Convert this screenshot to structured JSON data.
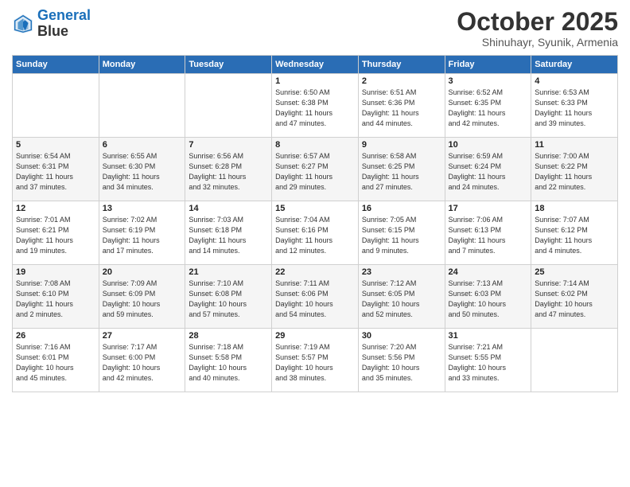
{
  "header": {
    "logo_line1": "General",
    "logo_line2": "Blue",
    "month": "October 2025",
    "location": "Shinuhayr, Syunik, Armenia"
  },
  "weekdays": [
    "Sunday",
    "Monday",
    "Tuesday",
    "Wednesday",
    "Thursday",
    "Friday",
    "Saturday"
  ],
  "weeks": [
    [
      {
        "day": "",
        "info": ""
      },
      {
        "day": "",
        "info": ""
      },
      {
        "day": "",
        "info": ""
      },
      {
        "day": "1",
        "info": "Sunrise: 6:50 AM\nSunset: 6:38 PM\nDaylight: 11 hours\nand 47 minutes."
      },
      {
        "day": "2",
        "info": "Sunrise: 6:51 AM\nSunset: 6:36 PM\nDaylight: 11 hours\nand 44 minutes."
      },
      {
        "day": "3",
        "info": "Sunrise: 6:52 AM\nSunset: 6:35 PM\nDaylight: 11 hours\nand 42 minutes."
      },
      {
        "day": "4",
        "info": "Sunrise: 6:53 AM\nSunset: 6:33 PM\nDaylight: 11 hours\nand 39 minutes."
      }
    ],
    [
      {
        "day": "5",
        "info": "Sunrise: 6:54 AM\nSunset: 6:31 PM\nDaylight: 11 hours\nand 37 minutes."
      },
      {
        "day": "6",
        "info": "Sunrise: 6:55 AM\nSunset: 6:30 PM\nDaylight: 11 hours\nand 34 minutes."
      },
      {
        "day": "7",
        "info": "Sunrise: 6:56 AM\nSunset: 6:28 PM\nDaylight: 11 hours\nand 32 minutes."
      },
      {
        "day": "8",
        "info": "Sunrise: 6:57 AM\nSunset: 6:27 PM\nDaylight: 11 hours\nand 29 minutes."
      },
      {
        "day": "9",
        "info": "Sunrise: 6:58 AM\nSunset: 6:25 PM\nDaylight: 11 hours\nand 27 minutes."
      },
      {
        "day": "10",
        "info": "Sunrise: 6:59 AM\nSunset: 6:24 PM\nDaylight: 11 hours\nand 24 minutes."
      },
      {
        "day": "11",
        "info": "Sunrise: 7:00 AM\nSunset: 6:22 PM\nDaylight: 11 hours\nand 22 minutes."
      }
    ],
    [
      {
        "day": "12",
        "info": "Sunrise: 7:01 AM\nSunset: 6:21 PM\nDaylight: 11 hours\nand 19 minutes."
      },
      {
        "day": "13",
        "info": "Sunrise: 7:02 AM\nSunset: 6:19 PM\nDaylight: 11 hours\nand 17 minutes."
      },
      {
        "day": "14",
        "info": "Sunrise: 7:03 AM\nSunset: 6:18 PM\nDaylight: 11 hours\nand 14 minutes."
      },
      {
        "day": "15",
        "info": "Sunrise: 7:04 AM\nSunset: 6:16 PM\nDaylight: 11 hours\nand 12 minutes."
      },
      {
        "day": "16",
        "info": "Sunrise: 7:05 AM\nSunset: 6:15 PM\nDaylight: 11 hours\nand 9 minutes."
      },
      {
        "day": "17",
        "info": "Sunrise: 7:06 AM\nSunset: 6:13 PM\nDaylight: 11 hours\nand 7 minutes."
      },
      {
        "day": "18",
        "info": "Sunrise: 7:07 AM\nSunset: 6:12 PM\nDaylight: 11 hours\nand 4 minutes."
      }
    ],
    [
      {
        "day": "19",
        "info": "Sunrise: 7:08 AM\nSunset: 6:10 PM\nDaylight: 11 hours\nand 2 minutes."
      },
      {
        "day": "20",
        "info": "Sunrise: 7:09 AM\nSunset: 6:09 PM\nDaylight: 10 hours\nand 59 minutes."
      },
      {
        "day": "21",
        "info": "Sunrise: 7:10 AM\nSunset: 6:08 PM\nDaylight: 10 hours\nand 57 minutes."
      },
      {
        "day": "22",
        "info": "Sunrise: 7:11 AM\nSunset: 6:06 PM\nDaylight: 10 hours\nand 54 minutes."
      },
      {
        "day": "23",
        "info": "Sunrise: 7:12 AM\nSunset: 6:05 PM\nDaylight: 10 hours\nand 52 minutes."
      },
      {
        "day": "24",
        "info": "Sunrise: 7:13 AM\nSunset: 6:03 PM\nDaylight: 10 hours\nand 50 minutes."
      },
      {
        "day": "25",
        "info": "Sunrise: 7:14 AM\nSunset: 6:02 PM\nDaylight: 10 hours\nand 47 minutes."
      }
    ],
    [
      {
        "day": "26",
        "info": "Sunrise: 7:16 AM\nSunset: 6:01 PM\nDaylight: 10 hours\nand 45 minutes."
      },
      {
        "day": "27",
        "info": "Sunrise: 7:17 AM\nSunset: 6:00 PM\nDaylight: 10 hours\nand 42 minutes."
      },
      {
        "day": "28",
        "info": "Sunrise: 7:18 AM\nSunset: 5:58 PM\nDaylight: 10 hours\nand 40 minutes."
      },
      {
        "day": "29",
        "info": "Sunrise: 7:19 AM\nSunset: 5:57 PM\nDaylight: 10 hours\nand 38 minutes."
      },
      {
        "day": "30",
        "info": "Sunrise: 7:20 AM\nSunset: 5:56 PM\nDaylight: 10 hours\nand 35 minutes."
      },
      {
        "day": "31",
        "info": "Sunrise: 7:21 AM\nSunset: 5:55 PM\nDaylight: 10 hours\nand 33 minutes."
      },
      {
        "day": "",
        "info": ""
      }
    ]
  ]
}
